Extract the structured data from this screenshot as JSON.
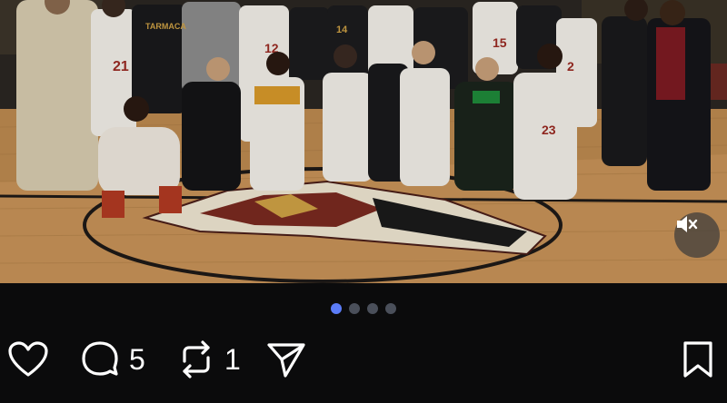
{
  "post": {
    "media_alt": "Team photo on basketball court",
    "carousel": {
      "total": 4,
      "active_index": 0
    }
  },
  "scene": {
    "banner_text": "TARMACA",
    "jersey_numbers": [
      "21",
      "12",
      "14",
      "15",
      "2",
      "23"
    ]
  },
  "media_controls": {
    "mute_icon": "speaker-muted-icon"
  },
  "actions": {
    "like_icon": "heart-icon",
    "comment_icon": "comment-bubble-icon",
    "comment_count": "5",
    "repost_icon": "repost-arrows-icon",
    "repost_count": "1",
    "share_icon": "paper-plane-icon",
    "bookmark_icon": "bookmark-icon"
  },
  "colors": {
    "background": "#0b0b0c",
    "dot_active": "#5b7cf7",
    "dot_inactive": "#4a4f5a",
    "icon": "#ffffff"
  }
}
